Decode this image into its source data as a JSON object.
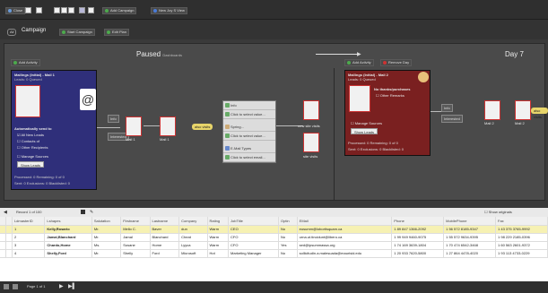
{
  "toolbar": {
    "close": "Close",
    "add_campaign": "Add Campaign",
    "new_campaign": "New Joy S View"
  },
  "campaign": {
    "all_tab": "All",
    "title": "Campaign",
    "btn_a": "Start Campaign",
    "btn_b": "Edit Plan"
  },
  "lanes": {
    "paused_label": "Paused",
    "paused_sub": "Dashboards",
    "day7_label": "Day 7",
    "add_activity_1": "Add Activity",
    "add_activity_2": "Add Activity",
    "remove_day": "Remove Day"
  },
  "card_left": {
    "title": "Mailings (Initial) - Mail 1",
    "sub": "Leads: 0  Queued",
    "section": "Automatically send to",
    "opt1": "All New Leads",
    "opt2": "Contacts of",
    "opt3": "Other Recipients",
    "manage": "Manage Sources",
    "show": "Show Leads",
    "stats1": "Processed: 0  Remaining: 0  of 0",
    "stats2": "Sent: 0  Exclusions: 0  Blacklisted: 0"
  },
  "card_right": {
    "title": "Mailings (Initial) - Mail 2",
    "sub": "Leads: 0  Queued",
    "flag": "No thanks/purchases",
    "opt1": "Other Remarks",
    "manage": "Manage Sources",
    "show": "Show Leads",
    "stats1": "Processed: 0  Remaining: 0  of 0",
    "stats2": "Sent: 0  Exclusions: 0  Blacklisted: 0"
  },
  "nodes": {
    "n1": "Info",
    "n2": "Interested",
    "n3": "Info",
    "n4": "Interested",
    "m1": "Mail 1",
    "m2": "Mail 1",
    "m3": "Mail 2",
    "m4": "Mail 2",
    "chip1": "also visits",
    "chip2": "also visits",
    "node_r1": "new site visits",
    "node_r2": "site visits"
  },
  "panel": {
    "r1": "Info",
    "r2": "Click to select value...",
    "r3": "Spring...",
    "r4": "Click to select value...",
    "r5": "E-Mail Types",
    "r6": "Click to select email..."
  },
  "grid": {
    "record_label": "Record 1 of 100",
    "show_originals": "Show originals",
    "columns": [
      "",
      "",
      "LdmasterID",
      "Lshapes",
      "Salutation",
      "Firstname",
      "Lastname",
      "Company",
      "Rating",
      "JobTitle",
      "Optin",
      "EMail",
      "Phone",
      "MobilePhone",
      "Fax"
    ],
    "rows": [
      [
        "",
        "",
        "1",
        "Kelly,Rosario",
        "Mr.",
        "Mello C.",
        "Baver",
        "dun",
        "Warm",
        "CEO",
        "No",
        "eusumm@lobortisquam.ca",
        "1 89 847 1366-2092",
        "1 56 572 8185-9347",
        "1 43 375 3765-9992"
      ],
      [
        "",
        "",
        "2",
        "Jamal,Blanchard",
        "Mr.",
        "Jamal",
        "Blanchard",
        "Cheat",
        "Warm",
        "CFO",
        "No",
        "urna.ut.tincidunt@libero.ca",
        "1 99 949 9460-9075",
        "1 55 572 9634-9395",
        "1 98 229 2185-0396"
      ],
      [
        "",
        "",
        "3",
        "Chardo,Home",
        "Ms.",
        "Susane",
        "Home",
        "Lyyca",
        "Warm",
        "CFO",
        "Yes",
        "sed@ipsummassa.org",
        "1 74 169 3639-1804",
        "1 70 474 6542-3468",
        "1 60 563 2601-9372"
      ],
      [
        "",
        "",
        "4",
        "Shelly,Ford",
        "Mr.",
        "Shelly",
        "Ford",
        "Microsoft",
        "Hot",
        "Marketing Manager",
        "No",
        "sollicitudin.a.malesuada@maurisid.edu",
        "1 20 933 7620-5800",
        "1 27 864 4478-4020",
        "1 93 113 4733-0229"
      ]
    ]
  },
  "footer": {
    "page_label": "Page 1 of 1"
  }
}
